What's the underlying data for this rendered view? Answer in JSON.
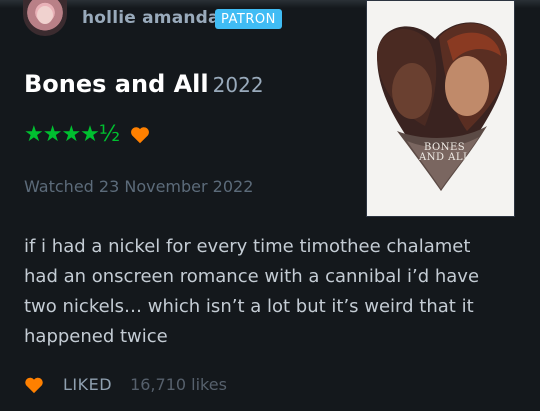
{
  "user": {
    "name": "hollie amanda",
    "badge": "PATRON"
  },
  "film": {
    "title": "Bones and All",
    "year": "2022",
    "poster_text_line1": "BONES",
    "poster_text_line2": "AND ALL"
  },
  "rating": {
    "stars": "★★★★½",
    "value": 4.5,
    "liked": true
  },
  "watched": "Watched 23 November 2022",
  "review": {
    "text": "if i had a nickel for every time timothee chalamet had an onscreen romance with a cannibal i’d have two nickels… which isn’t a lot but it’s weird that it happened twice"
  },
  "likes": {
    "label": "LIKED",
    "count": "16,710 likes"
  },
  "colors": {
    "background": "#14181c",
    "star_green": "#00c030",
    "heart_orange": "#ff8000",
    "badge_blue": "#40bcf4"
  }
}
